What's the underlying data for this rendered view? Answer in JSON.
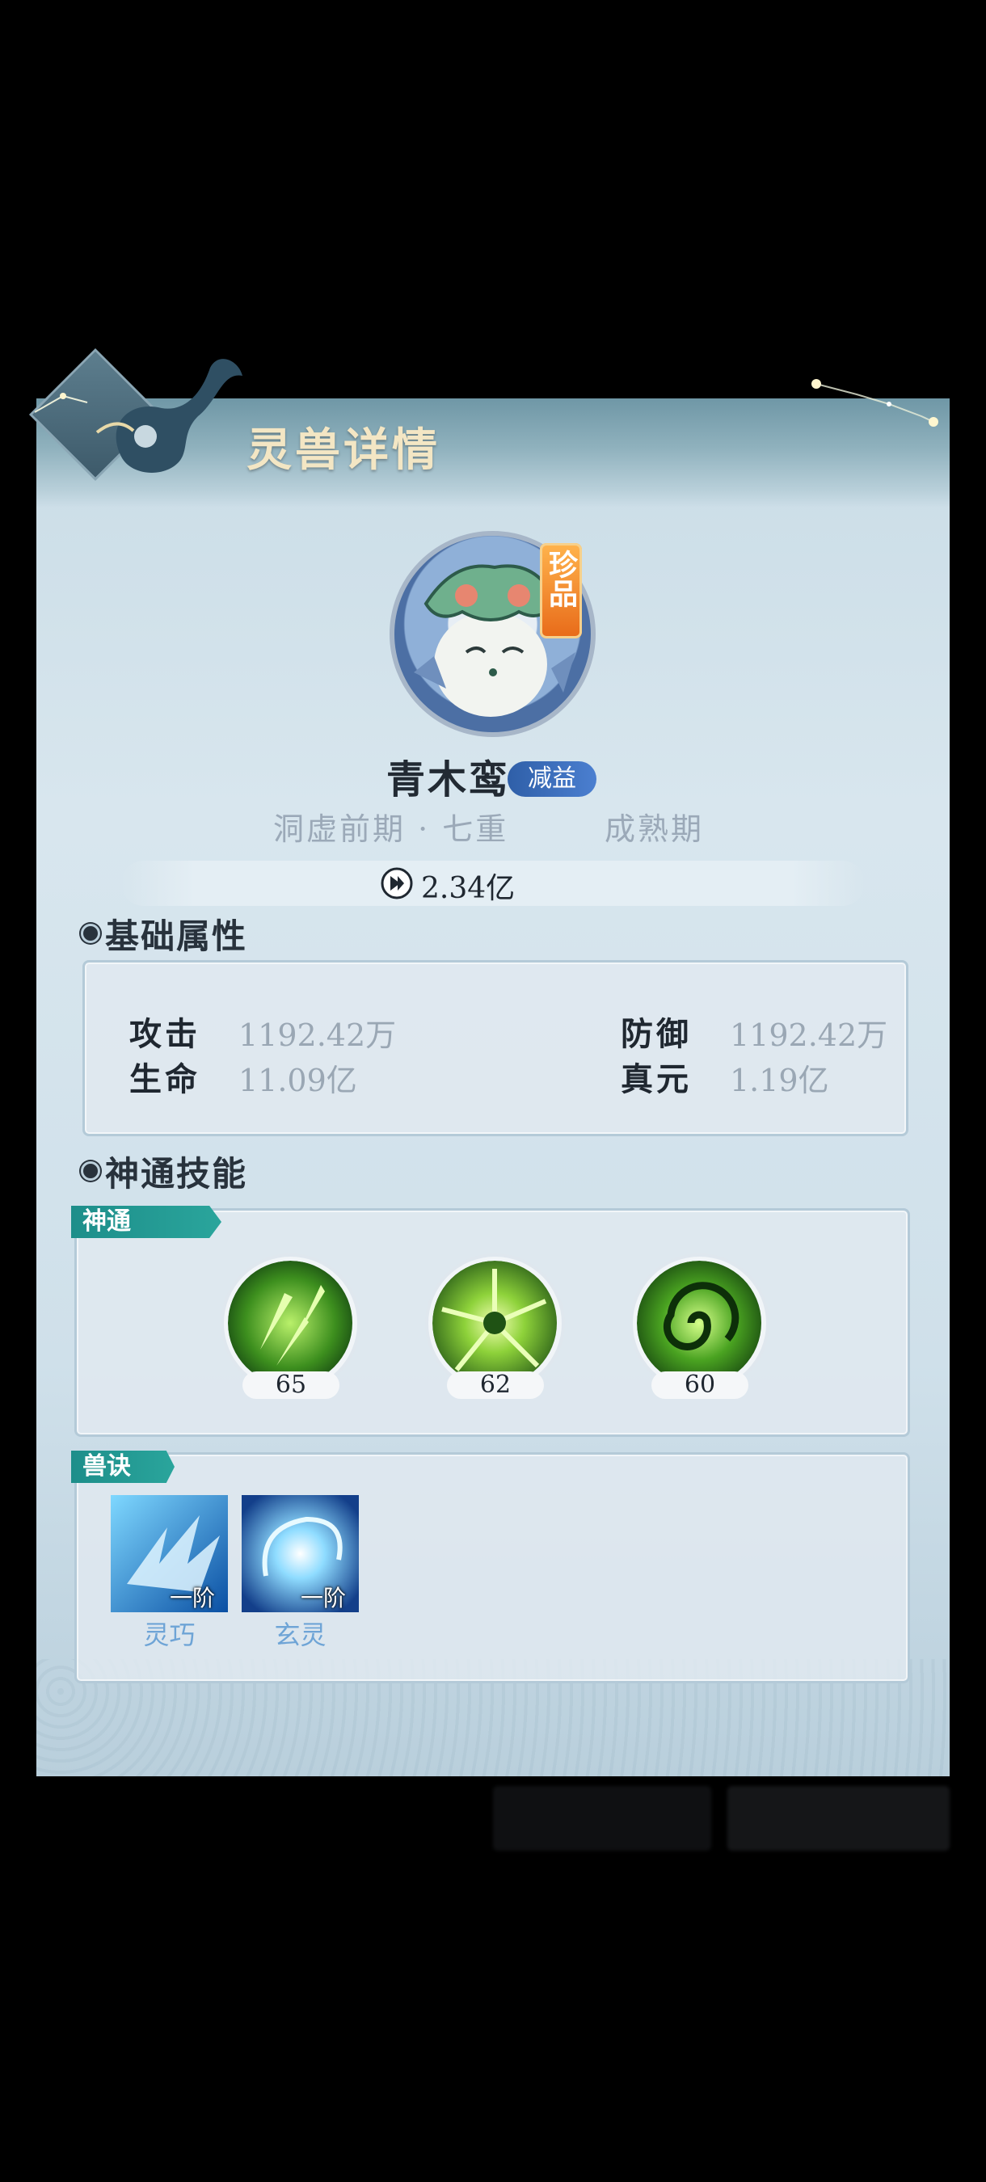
{
  "header": {
    "title": "灵兽详情"
  },
  "pet": {
    "rarity": "珍品",
    "name": "青木鸾",
    "tag": "减益",
    "realm": "洞虚前期 · 七重",
    "stage": "成熟期",
    "power": "2.34亿"
  },
  "basic_attributes": {
    "title": "基础属性",
    "stats": [
      {
        "label": "攻击",
        "value": "1192.42万"
      },
      {
        "label": "防御",
        "value": "1192.42万"
      },
      {
        "label": "生命",
        "value": "11.09亿"
      },
      {
        "label": "真元",
        "value": "1.19亿"
      }
    ]
  },
  "skills": {
    "title": "神通技能",
    "shentong_tab": "神通",
    "shentong": [
      {
        "icon": "green-shards-skill-icon",
        "level": "65"
      },
      {
        "icon": "green-burst-skill-icon",
        "level": "62"
      },
      {
        "icon": "green-vortex-skill-icon",
        "level": "60"
      }
    ],
    "shoujue_tab": "兽诀",
    "shoujue": [
      {
        "icon": "blue-claw-icon",
        "rank": "一阶",
        "name": "灵巧"
      },
      {
        "icon": "blue-orb-icon",
        "rank": "一阶",
        "name": "玄灵"
      }
    ]
  },
  "colors": {
    "accent_teal": "#2aa59c",
    "tag_blue": "#3a6fbf",
    "rarity_orange": "#f08a25",
    "jue_name": "#6ea4d6"
  }
}
